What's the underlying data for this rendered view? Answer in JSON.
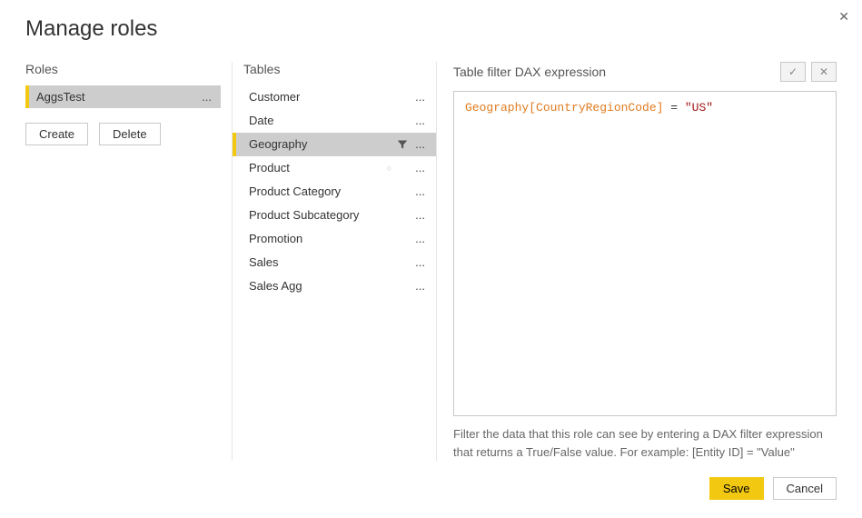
{
  "dialog": {
    "title": "Manage roles",
    "close_symbol": "✕"
  },
  "roles_section": {
    "title": "Roles",
    "items": [
      {
        "label": "AggsTest",
        "selected": true
      }
    ],
    "create_label": "Create",
    "delete_label": "Delete"
  },
  "tables_section": {
    "title": "Tables",
    "items": [
      {
        "label": "Customer",
        "selected": false,
        "hasFilter": false
      },
      {
        "label": "Date",
        "selected": false,
        "hasFilter": false
      },
      {
        "label": "Geography",
        "selected": true,
        "hasFilter": true
      },
      {
        "label": "Product",
        "selected": false,
        "hasFilter": false,
        "marker": true
      },
      {
        "label": "Product Category",
        "selected": false,
        "hasFilter": false
      },
      {
        "label": "Product Subcategory",
        "selected": false,
        "hasFilter": false
      },
      {
        "label": "Promotion",
        "selected": false,
        "hasFilter": false
      },
      {
        "label": "Sales",
        "selected": false,
        "hasFilter": false
      },
      {
        "label": "Sales Agg",
        "selected": false,
        "hasFilter": false
      }
    ]
  },
  "expression_section": {
    "title": "Table filter DAX expression",
    "confirm_symbol": "✓",
    "cancel_symbol": "✕",
    "tokens": {
      "col": "Geography[CountryRegionCode]",
      "op": " = ",
      "str": "\"US\""
    },
    "value": "Geography[CountryRegionCode] = \"US\"",
    "help": "Filter the data that this role can see by entering a DAX filter expression that returns a True/False value. For example: [Entity ID] = \"Value\""
  },
  "footer": {
    "save_label": "Save",
    "cancel_label": "Cancel"
  },
  "more_symbol": "..."
}
